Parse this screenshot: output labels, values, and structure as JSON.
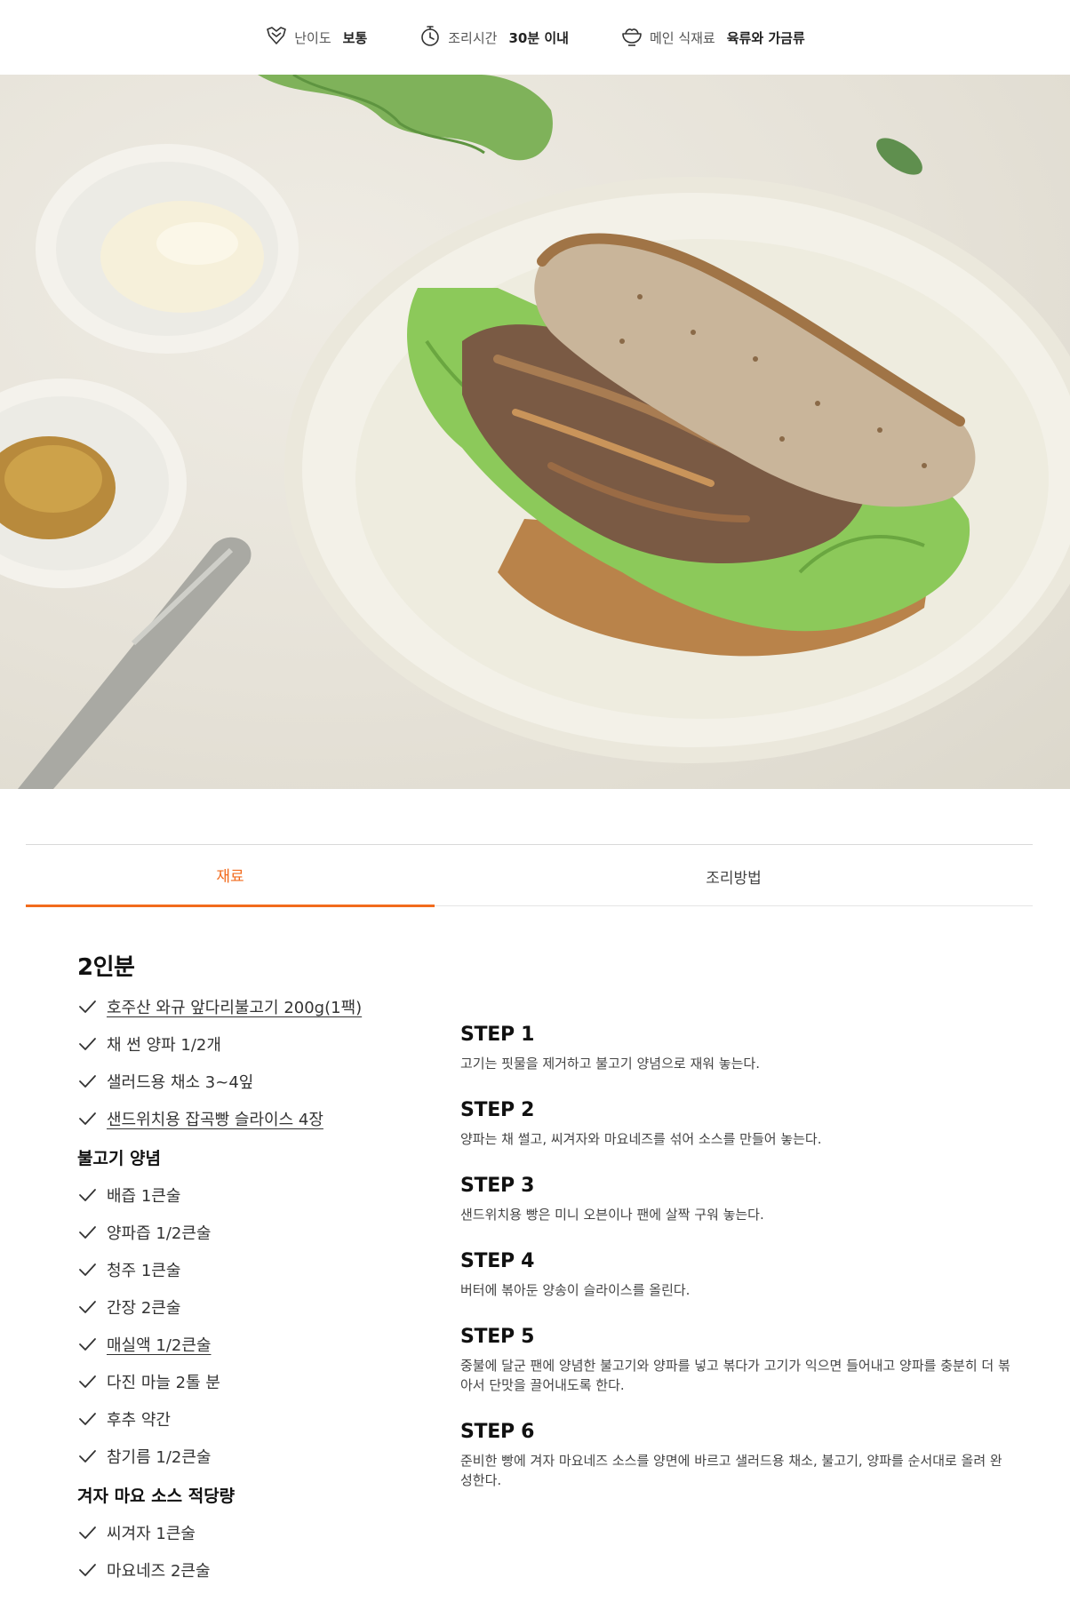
{
  "meta": {
    "difficulty": {
      "label": "난이도",
      "value": "보통",
      "icon": "difficulty-icon"
    },
    "cook_time": {
      "label": "조리시간",
      "value": "30분 이내",
      "icon": "timer-icon"
    },
    "main_ingredient": {
      "label": "메인 식재료",
      "value": "육류와 가금류",
      "icon": "bowl-icon"
    }
  },
  "tabs": [
    {
      "label": "재료",
      "active": true
    },
    {
      "label": "조리방법",
      "active": false
    }
  ],
  "colors": {
    "accent": "#f26b1d"
  },
  "ingredients": {
    "servings": "2인분",
    "main": [
      {
        "text": "호주산 와규 앞다리불고기 200g(1팩)",
        "linked": true
      },
      {
        "text": "채 썬 양파 1/2개",
        "linked": false
      },
      {
        "text": "샐러드용 채소 3~4잎",
        "linked": false
      },
      {
        "text": "샌드위치용 잡곡빵 슬라이스 4장",
        "linked": true
      }
    ],
    "groups": [
      {
        "title": "불고기 양념",
        "items": [
          {
            "text": "배즙 1큰술",
            "linked": false
          },
          {
            "text": "양파즙 1/2큰술",
            "linked": false
          },
          {
            "text": "청주 1큰술",
            "linked": false
          },
          {
            "text": "간장 2큰술",
            "linked": false
          },
          {
            "text": "매실액 1/2큰술",
            "linked": true
          },
          {
            "text": "다진 마늘 2톨 분",
            "linked": false
          },
          {
            "text": "후추 약간",
            "linked": false
          },
          {
            "text": "참기름 1/2큰술",
            "linked": false
          }
        ]
      },
      {
        "title": "겨자 마요 소스 적당량",
        "items": [
          {
            "text": "씨겨자 1큰술",
            "linked": false
          },
          {
            "text": "마요네즈 2큰술",
            "linked": false
          }
        ]
      }
    ]
  },
  "steps": [
    {
      "title": "STEP 1",
      "desc": "고기는 핏물을 제거하고 불고기 양념으로 재워 놓는다."
    },
    {
      "title": "STEP 2",
      "desc": "양파는 채 썰고, 씨겨자와 마요네즈를 섞어 소스를 만들어 놓는다."
    },
    {
      "title": "STEP 3",
      "desc": "샌드위치용 빵은 미니 오븐이나 팬에 살짝 구워 놓는다."
    },
    {
      "title": "STEP 4",
      "desc": "버터에 볶아둔 양송이 슬라이스를 올린다."
    },
    {
      "title": "STEP 5",
      "desc": "중불에 달군 팬에 양념한 불고기와 양파를 넣고 볶다가 고기가 익으면 들어내고 양파를 충분히 더 볶아서 단맛을 끌어내도록 한다."
    },
    {
      "title": "STEP 6",
      "desc": "준비한 빵에 겨자 마요네즈 소스를 양면에 바르고 샐러드용 채소, 불고기, 양파를 순서대로 올려 완성한다."
    }
  ]
}
